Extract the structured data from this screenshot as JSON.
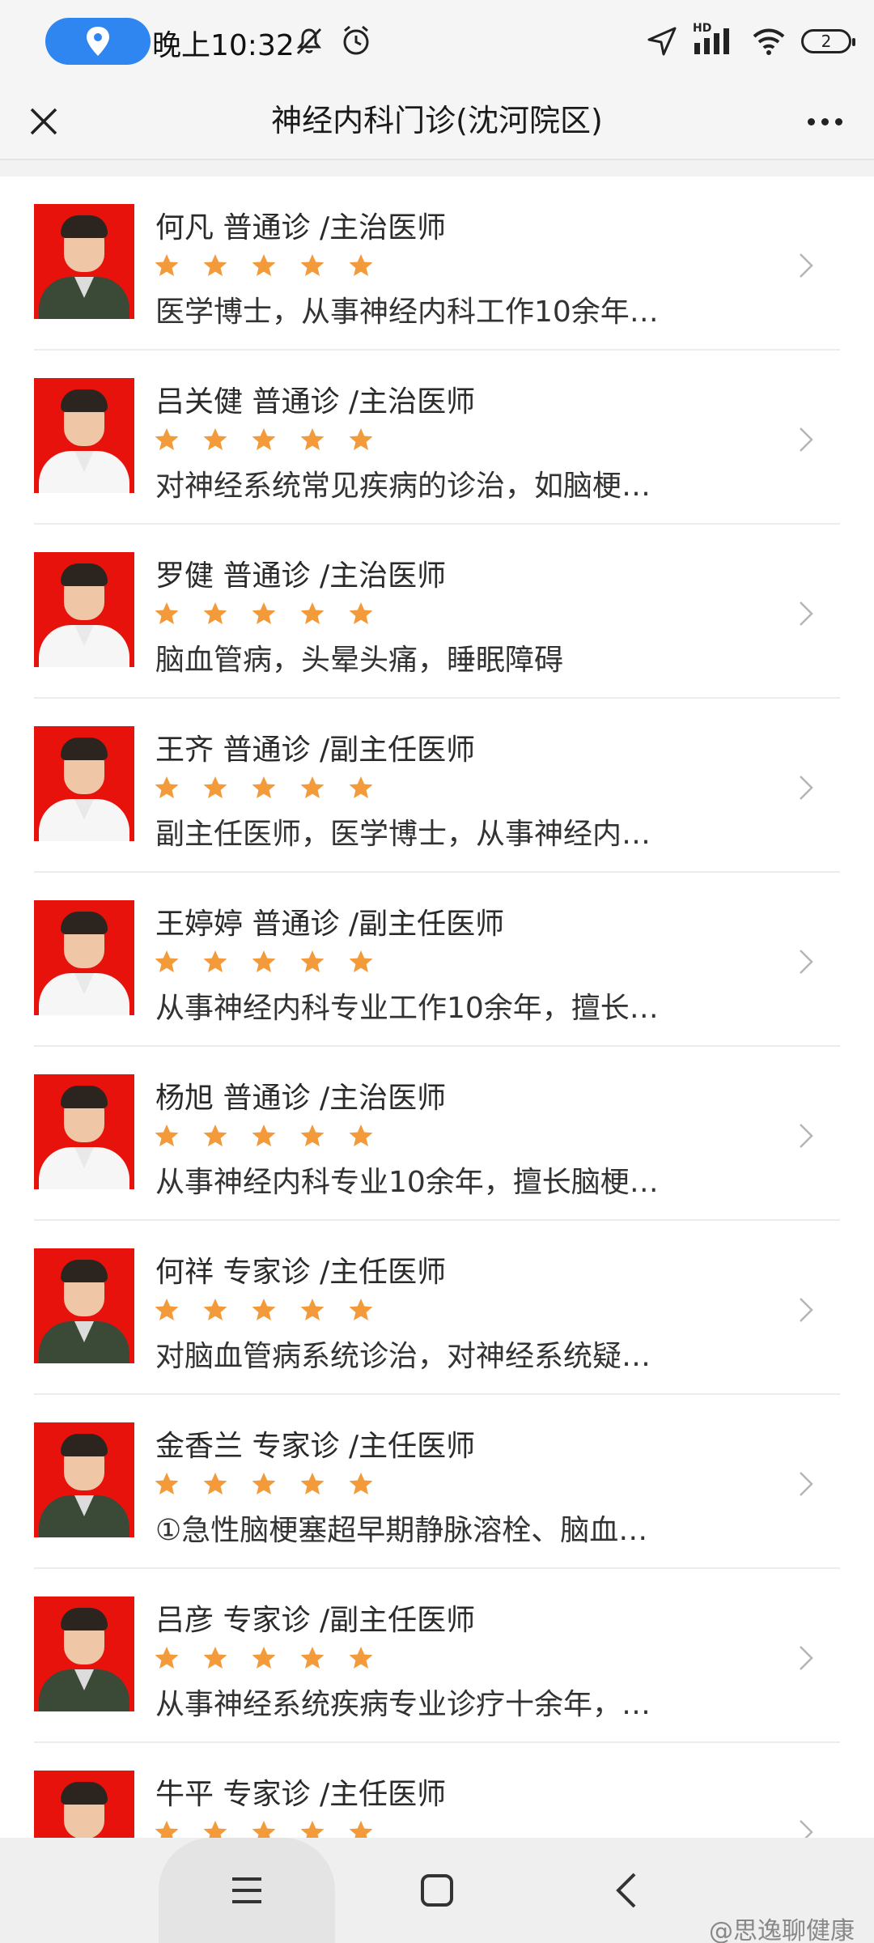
{
  "status_bar": {
    "time": "晚上10:32",
    "network": "HD",
    "battery": "2"
  },
  "header": {
    "title": "神经内科门诊(沈河院区)"
  },
  "doctors": [
    {
      "name": "何凡",
      "clinic": "普通诊",
      "title": "/主治医师",
      "rating": 5,
      "desc": "医学博士，从事神经内科工作10余年…",
      "uniform": "military"
    },
    {
      "name": "吕关健",
      "clinic": "普通诊",
      "title": "/主治医师",
      "rating": 5,
      "desc": "对神经系统常见疾病的诊治，如脑梗…",
      "uniform": "white"
    },
    {
      "name": "罗健",
      "clinic": "普通诊",
      "title": "/主治医师",
      "rating": 5,
      "desc": "脑血管病，头晕头痛，睡眠障碍",
      "uniform": "white"
    },
    {
      "name": "王齐",
      "clinic": "普通诊",
      "title": "/副主任医师",
      "rating": 5,
      "desc": "副主任医师，医学博士，从事神经内…",
      "uniform": "white"
    },
    {
      "name": "王婷婷",
      "clinic": "普通诊",
      "title": "/副主任医师",
      "rating": 5,
      "desc": "从事神经内科专业工作10余年，擅长…",
      "uniform": "white"
    },
    {
      "name": "杨旭",
      "clinic": "普通诊",
      "title": "/主治医师",
      "rating": 5,
      "desc": "从事神经内科专业10余年，擅长脑梗…",
      "uniform": "white"
    },
    {
      "name": "何祥",
      "clinic": "专家诊",
      "title": "/主任医师",
      "rating": 5,
      "desc": "对脑血管病系统诊治，对神经系统疑…",
      "uniform": "military"
    },
    {
      "name": "金香兰",
      "clinic": "专家诊",
      "title": "/主任医师",
      "rating": 5,
      "desc": "①急性脑梗塞超早期静脉溶栓、脑血…",
      "uniform": "military"
    },
    {
      "name": "吕彦",
      "clinic": "专家诊",
      "title": "/副主任医师",
      "rating": 5,
      "desc": "从事神经系统疾病专业诊疗十余年，…",
      "uniform": "military"
    },
    {
      "name": "牛平",
      "clinic": "专家诊",
      "title": "/主任医师",
      "rating": 5,
      "desc": "",
      "uniform": "white"
    }
  ],
  "icons": {
    "location": "location-pin-icon",
    "close": "close-icon",
    "more": "more-dots-icon",
    "star": "star-icon",
    "chevron": "chevron-right-icon",
    "nav_menu": "menu-icon",
    "nav_home": "home-square-icon",
    "nav_back": "back-icon"
  },
  "colors": {
    "star": "#f39a3a",
    "location_pill": "#2f86f0",
    "avatar_bg": "#e8120c"
  },
  "watermark": "@思逸聊健康"
}
